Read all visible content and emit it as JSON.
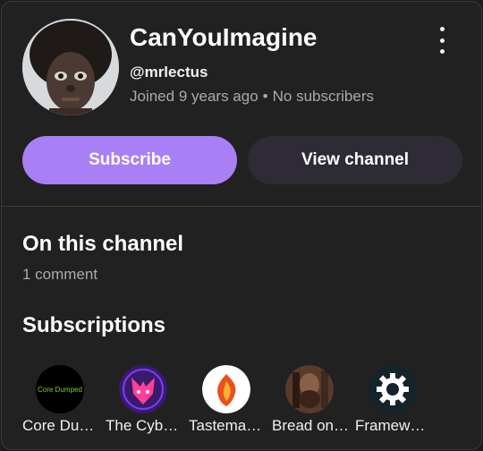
{
  "channel": {
    "name": "CanYouImagine",
    "handle": "@mrlectus",
    "joined": "Joined 9 years ago",
    "separator": "•",
    "subscribers": "No subscribers"
  },
  "actions": {
    "subscribe_label": "Subscribe",
    "view_channel_label": "View channel"
  },
  "on_channel": {
    "heading": "On this channel",
    "comments": "1 comment"
  },
  "subscriptions": {
    "heading": "Subscriptions",
    "items": [
      {
        "name": "Core Du…",
        "thumb_text": "Core Dumped",
        "thumb_bg": "#000000"
      },
      {
        "name": "The Cyb…",
        "thumb_bg": "#3a1a6b"
      },
      {
        "name": "Tastema…",
        "thumb_bg": "#ffffff"
      },
      {
        "name": "Bread on…",
        "thumb_bg": "#5a3a2a"
      },
      {
        "name": "Framew…",
        "thumb_bg": "#15232b"
      }
    ]
  },
  "colors": {
    "accent": "#a97ff5",
    "secondary_button": "#2e2b36",
    "background": "#212121"
  }
}
